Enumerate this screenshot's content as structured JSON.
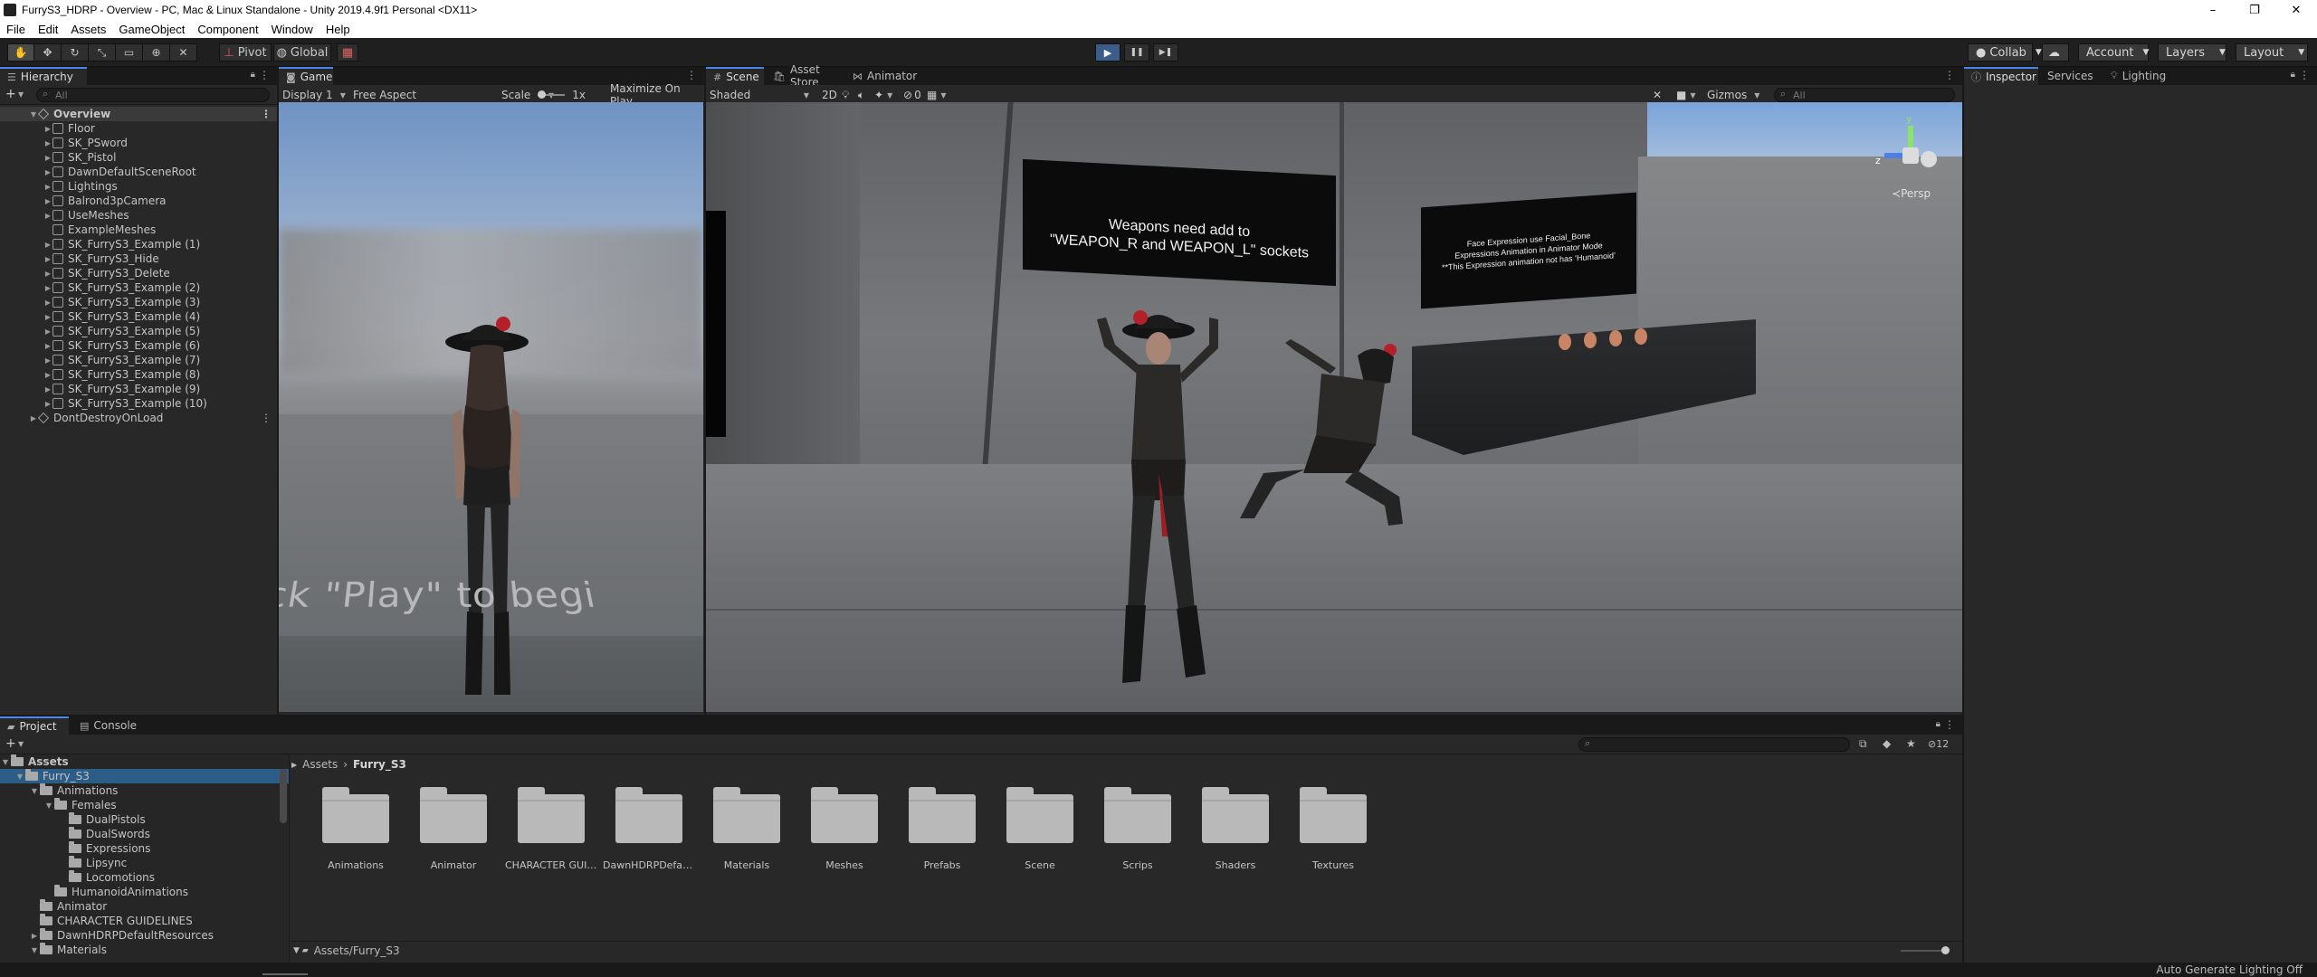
{
  "window": {
    "title": "FurryS3_HDRP - Overview - PC, Mac & Linux Standalone - Unity 2019.4.9f1 Personal <DX11>",
    "controls": [
      "–",
      "❐",
      "✕"
    ]
  },
  "menu": [
    "File",
    "Edit",
    "Assets",
    "GameObject",
    "Component",
    "Window",
    "Help"
  ],
  "toolbar": {
    "pivot_label": "Pivot",
    "global_label": "Global",
    "collab_label": "Collab",
    "account_label": "Account",
    "layers_label": "Layers",
    "layout_label": "Layout",
    "play_icon": "▶",
    "pause_icon": "❚❚",
    "step_icon": "▶❚"
  },
  "hierarchy": {
    "tab_label": "Hierarchy",
    "search_placeholder": "All",
    "scene_name": "Overview",
    "items": [
      "Floor",
      "SK_PSword",
      "SK_Pistol",
      "DawnDefaultSceneRoot",
      "Lightings",
      "Balrond3pCamera",
      "UseMeshes",
      "ExampleMeshes",
      "SK_FurryS3_Example (1)",
      "SK_FurryS3_Hide",
      "SK_FurryS3_Delete",
      "SK_FurryS3_Example (2)",
      "SK_FurryS3_Example (3)",
      "SK_FurryS3_Example (4)",
      "SK_FurryS3_Example (5)",
      "SK_FurryS3_Example (6)",
      "SK_FurryS3_Example (7)",
      "SK_FurryS3_Example (8)",
      "SK_FurryS3_Example (9)",
      "SK_FurryS3_Example (10)"
    ],
    "dont_destroy": "DontDestroyOnLoad"
  },
  "game": {
    "tab_label": "Game",
    "display": "Display 1",
    "aspect": "Free Aspect",
    "scale_label": "Scale",
    "scale_value": "1x",
    "maximize": "Maximize On Play",
    "overlay_text": "ck \"Play\" to begi"
  },
  "scene": {
    "tabs": [
      "Scene",
      "Asset Store",
      "Animator"
    ],
    "shading": "Shaded",
    "mode_2d": "2D",
    "fx_count": "0",
    "gizmos": "Gizmos",
    "search_placeholder": "All",
    "persp_label": "Persp",
    "axis_y": "y",
    "axis_z": "z",
    "sign_main": "Weapons need add to\n\"WEAPON_R and WEAPON_L\" sockets",
    "sign_small": "Face Expression use Facial_Bone\nExpressions Animation in Animator Mode\n**This Expression animation not has ‘Humanoid’"
  },
  "inspector": {
    "tabs": [
      "Inspector",
      "Services",
      "Lighting"
    ]
  },
  "project": {
    "tabs": [
      "Project",
      "Console"
    ],
    "breadcrumb_root": "Assets",
    "breadcrumb_sep": "›",
    "breadcrumb_current": "Furry_S3",
    "badge_count": "12",
    "tree": [
      {
        "label": "Assets",
        "depth": 0,
        "bold": true,
        "arrow": "▼"
      },
      {
        "label": "Furry_S3",
        "depth": 1,
        "arrow": "▼",
        "selected": true
      },
      {
        "label": "Animations",
        "depth": 2,
        "arrow": "▼"
      },
      {
        "label": "Females",
        "depth": 3,
        "arrow": "▼"
      },
      {
        "label": "DualPistols",
        "depth": 4,
        "arrow": ""
      },
      {
        "label": "DualSwords",
        "depth": 4,
        "arrow": ""
      },
      {
        "label": "Expressions",
        "depth": 4,
        "arrow": ""
      },
      {
        "label": "Lipsync",
        "depth": 4,
        "arrow": ""
      },
      {
        "label": "Locomotions",
        "depth": 4,
        "arrow": ""
      },
      {
        "label": "HumanoidAnimations",
        "depth": 3,
        "arrow": ""
      },
      {
        "label": "Animator",
        "depth": 2,
        "arrow": ""
      },
      {
        "label": "CHARACTER GUIDELINES",
        "depth": 2,
        "arrow": ""
      },
      {
        "label": "DawnHDRPDefaultResources",
        "depth": 2,
        "arrow": "▶"
      },
      {
        "label": "Materials",
        "depth": 2,
        "arrow": "▼"
      }
    ],
    "folders": [
      "Animations",
      "Animator",
      "CHARACTER GUIDELINES",
      "DawnHDRPDefaultResources",
      "Materials",
      "Meshes",
      "Prefabs",
      "Scene",
      "Scrips",
      "Shaders",
      "Textures"
    ],
    "footer_path": "Assets/Furry_S3"
  },
  "status": {
    "right_text": "Auto Generate Lighting Off"
  }
}
